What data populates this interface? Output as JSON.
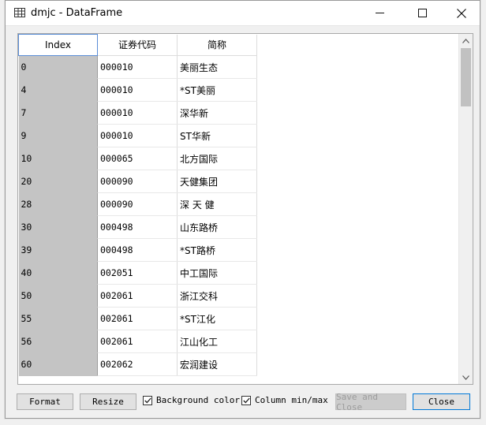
{
  "window": {
    "title": "dmjc - DataFrame"
  },
  "table": {
    "headers": [
      "Index",
      "证券代码",
      "简称"
    ],
    "rows": [
      {
        "index": "0",
        "code": "000010",
        "name": "美丽生态"
      },
      {
        "index": "4",
        "code": "000010",
        "name": "*ST美丽"
      },
      {
        "index": "7",
        "code": "000010",
        "name": "深华新"
      },
      {
        "index": "9",
        "code": "000010",
        "name": "ST华新"
      },
      {
        "index": "10",
        "code": "000065",
        "name": "北方国际"
      },
      {
        "index": "20",
        "code": "000090",
        "name": "天健集团"
      },
      {
        "index": "28",
        "code": "000090",
        "name": "深 天 健"
      },
      {
        "index": "30",
        "code": "000498",
        "name": "山东路桥"
      },
      {
        "index": "39",
        "code": "000498",
        "name": "*ST路桥"
      },
      {
        "index": "40",
        "code": "002051",
        "name": "中工国际"
      },
      {
        "index": "50",
        "code": "002061",
        "name": "浙江交科"
      },
      {
        "index": "55",
        "code": "002061",
        "name": "*ST江化"
      },
      {
        "index": "56",
        "code": "002061",
        "name": "江山化工"
      },
      {
        "index": "60",
        "code": "002062",
        "name": "宏润建设"
      }
    ]
  },
  "footer": {
    "format_label": "Format",
    "resize_label": "Resize",
    "background_color_label": "Background color",
    "background_color_checked": true,
    "column_minmax_label": "Column min/max",
    "column_minmax_checked": true,
    "save_close_label": "Save and Close",
    "close_label": "Close"
  },
  "icons": {
    "app": "table-grid-icon",
    "minimize": "minimize-icon",
    "maximize": "maximize-icon",
    "close": "close-icon",
    "scroll_up": "chevron-up-icon",
    "scroll_down": "chevron-down-icon",
    "checkbox": "checkmark-icon"
  },
  "colors": {
    "index_column_bg": "#c4c4c4",
    "close_button_border": "#0078d7",
    "header_index_border": "#5a8dd6"
  }
}
